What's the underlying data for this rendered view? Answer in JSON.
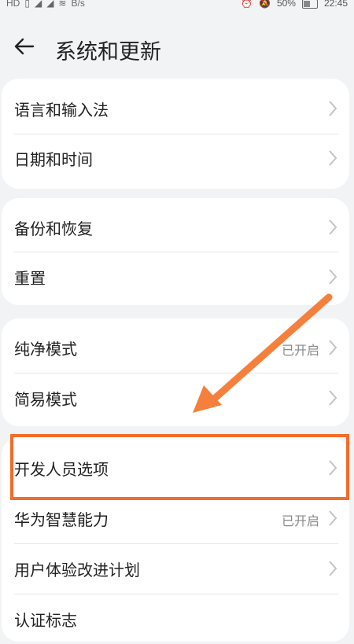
{
  "status_bar": {
    "left": [
      "HD",
      "▯",
      "◢",
      "◢",
      "≋",
      "B/s"
    ],
    "battery": "50%",
    "time": "22:45"
  },
  "header": {
    "title": "系统和更新"
  },
  "groups": [
    {
      "items": [
        {
          "label": "语言和输入法"
        },
        {
          "label": "日期和时间"
        }
      ]
    },
    {
      "items": [
        {
          "label": "备份和恢复"
        },
        {
          "label": "重置"
        }
      ]
    },
    {
      "items": [
        {
          "label": "纯净模式",
          "status": "已开启"
        },
        {
          "label": "简易模式"
        }
      ]
    },
    {
      "items": [
        {
          "label": "开发人员选项"
        },
        {
          "label": "华为智慧能力",
          "status": "已开启"
        },
        {
          "label": "用户体验改进计划"
        },
        {
          "label": "认证标志"
        }
      ]
    }
  ],
  "annotation": {
    "color": "#f26c2b"
  }
}
